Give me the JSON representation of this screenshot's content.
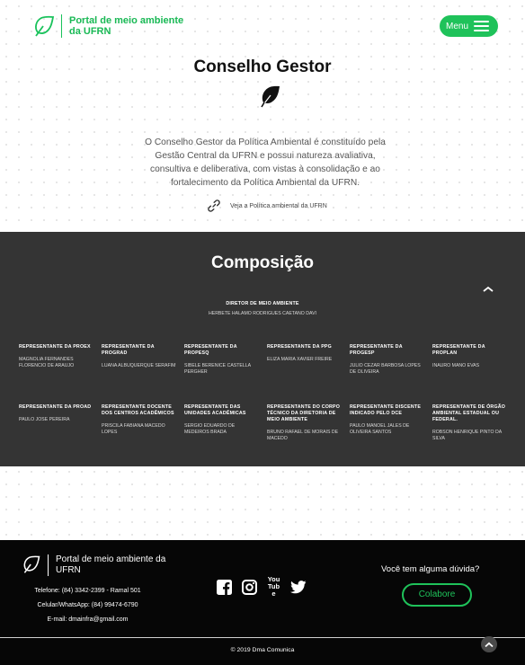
{
  "header": {
    "logo_text": "Portal de meio ambiente da UFRN",
    "menu_label": "Menu",
    "accent_color": "#1fc25a"
  },
  "intro": {
    "title": "Conselho Gestor",
    "text": "O Conselho Gestor da Política Ambiental é constituído pela Gestão Central da UFRN e possui natureza avaliativa, consultiva e deliberativa, com vistas à consolidação e ao fortalecimento da Política Ambiental da UFRN.",
    "link_label": "Veja a Política ambiental da UFRN",
    "link_icon": "link-icon",
    "leaf_icon": "leaf-icon"
  },
  "composicao": {
    "title": "Composição",
    "director": {
      "role": "DIRETOR DE MEIO AMBIENTE",
      "name": "HERBETE HALAMO RODRIGUES CAETANO DAVI"
    },
    "row1": [
      {
        "role": "Representante da PROEX",
        "name": "MAGNOLIA FERNANDES FLORENCIO DE ARAUJO"
      },
      {
        "role": "Representante da PROGRAD",
        "name": "LUANA ALBUQUERQUE SERAFIM"
      },
      {
        "role": "Representante da PROPESQ",
        "name": "SIBELE BERENICE CASTELLA PERGHER"
      },
      {
        "role": "Representante da PPG",
        "name": "ELIZA MARIA XAVIER FREIRE"
      },
      {
        "role": "Representante da PROGESP",
        "name": "JULIO CEZAR BARBOSA LOPES DE OLIVEIRA"
      },
      {
        "role": "Representante da PROPLAN",
        "name": "INAURO MANO EVAS"
      }
    ],
    "row2": [
      {
        "role": "Representante da PROAD",
        "name": "PAULO JOSE PEREIRA"
      },
      {
        "role": "Representante Docente dos Centros Acadêmicos",
        "name": "PRISCILA FABIANA MACEDO LOPES"
      },
      {
        "role": "Representante das Unidades Acadêmicas",
        "name": "SERGIO EDUARDO DE MEDEIROS BRADA"
      },
      {
        "role": "Representante do Corpo Técnico da Diretoria de Meio Ambiente",
        "name": "BRUNO RAFAEL DE MORAIS DE MACEDO"
      },
      {
        "role": "Representante Discente indicado pelo DCE",
        "name": "PAULO MANOEL JALES DE OLIVEIRA SANTOS"
      },
      {
        "role": "Representante de Órgão Ambiental Estadual ou Federal.",
        "name": "ROBSON HENRIQUE PINTO DA SILVA"
      }
    ]
  },
  "footer": {
    "logo_text": "Portal de meio ambiente da UFRN",
    "phone": "Telefone: (84) 3342-2399 - Ramal 501",
    "whatsapp": "Celular/WhatsApp: (84) 99474-6790",
    "email": "E-mail: dmainfra@gmail.com",
    "question": "Você tem alguma dúvida?",
    "collab_label": "Colabore",
    "copyright": "© 2019 Dma Comunica",
    "youtube_label": "You Tube",
    "socials": [
      "facebook-icon",
      "instagram-icon",
      "youtube-icon",
      "twitter-icon"
    ]
  }
}
